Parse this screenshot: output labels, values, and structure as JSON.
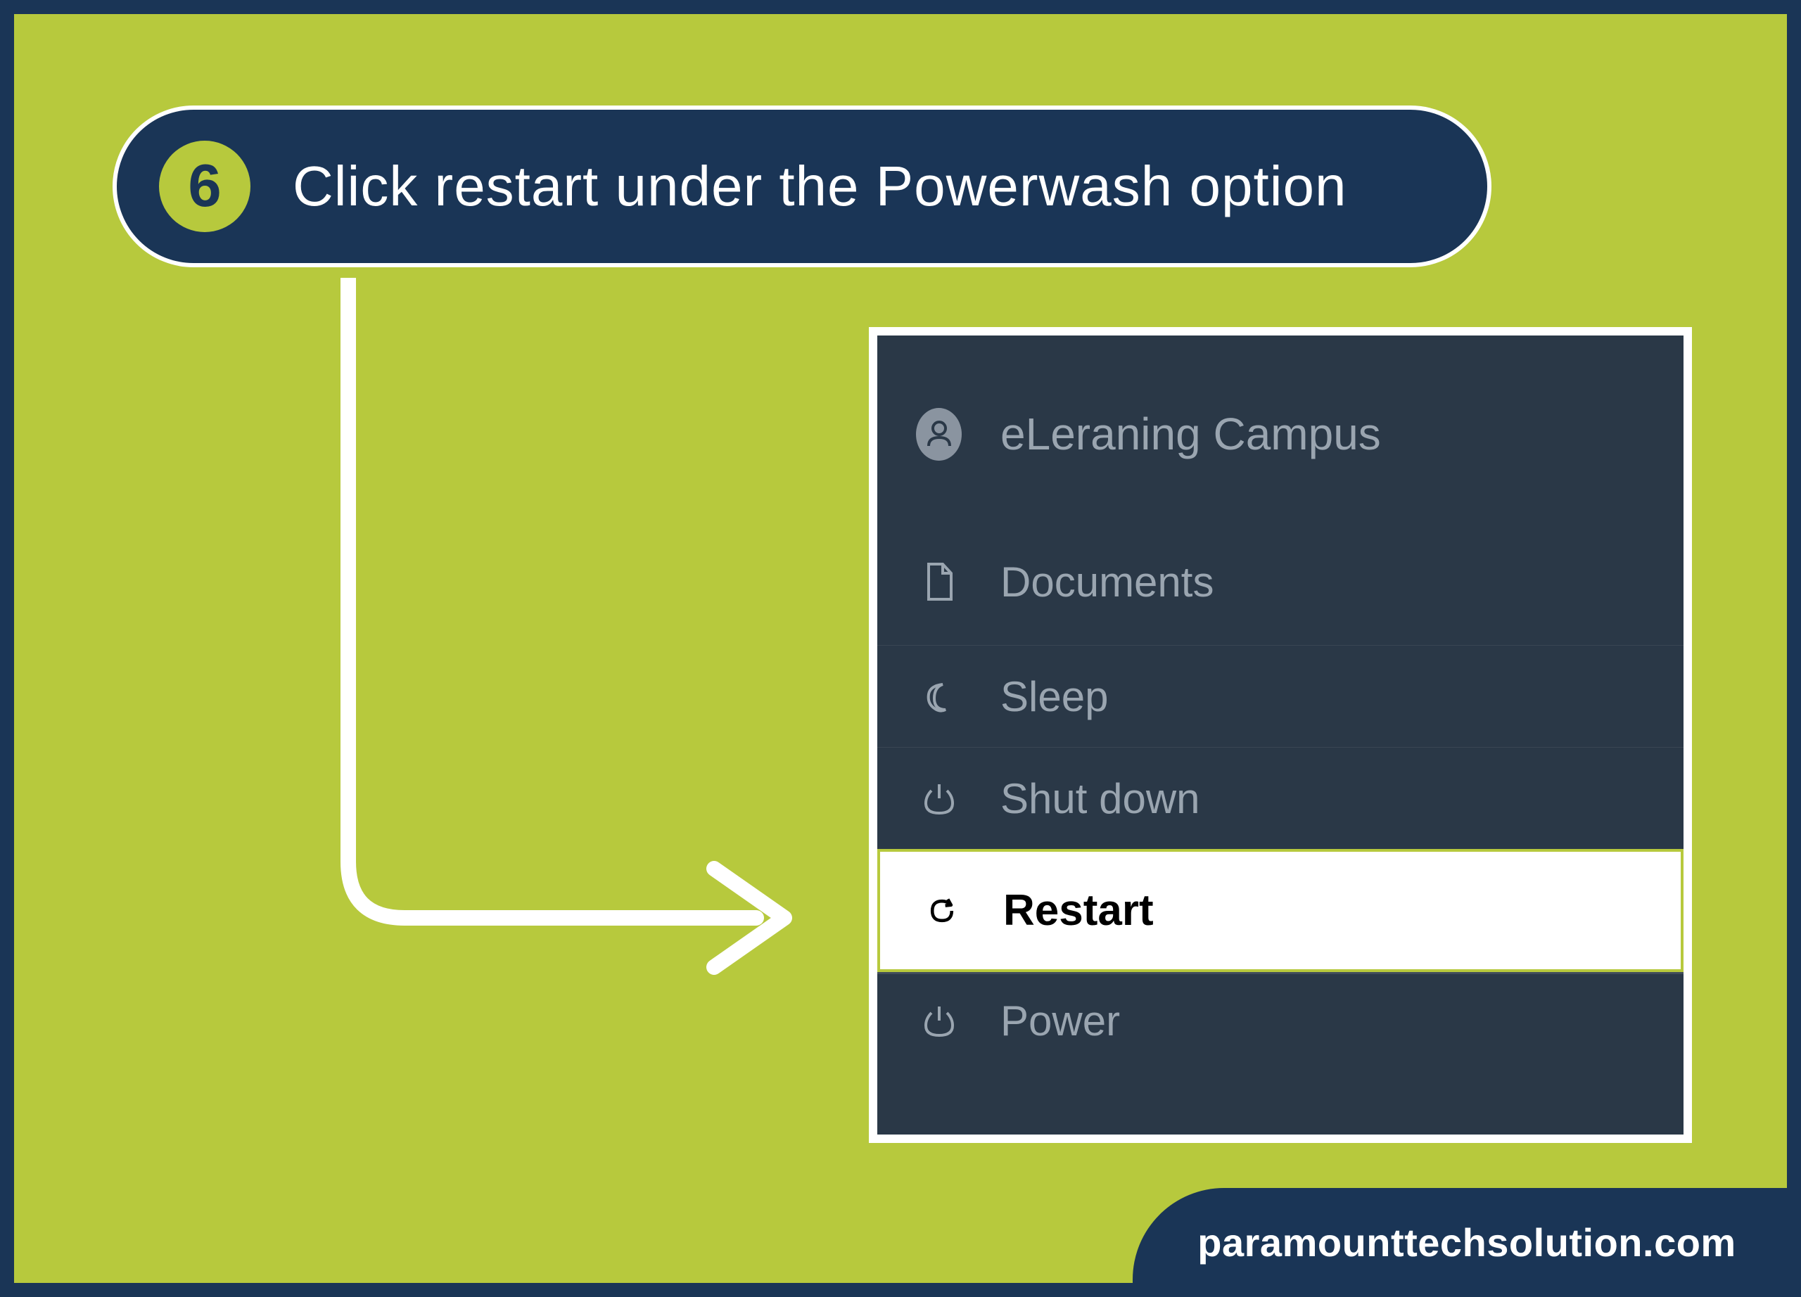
{
  "step": {
    "number": "6",
    "title": "Click restart under the Powerwash option"
  },
  "menu": {
    "items": [
      {
        "label": "eLeraning Campus",
        "icon": "user-icon"
      },
      {
        "label": "Documents",
        "icon": "document-icon"
      },
      {
        "label": "Sleep",
        "icon": "moon-icon"
      },
      {
        "label": "Shut down",
        "icon": "power-icon"
      },
      {
        "label": "Restart",
        "icon": "restart-icon"
      },
      {
        "label": "Power",
        "icon": "power-icon"
      }
    ]
  },
  "footer": {
    "domain": "paramounttechsolution.com"
  },
  "colors": {
    "background": "#b7c93d",
    "primary": "#1a3556",
    "menuBg": "#2a3847",
    "menuText": "#9aa5b0",
    "highlight": "#ffffff",
    "highlightBorder": "#b7c93d"
  }
}
